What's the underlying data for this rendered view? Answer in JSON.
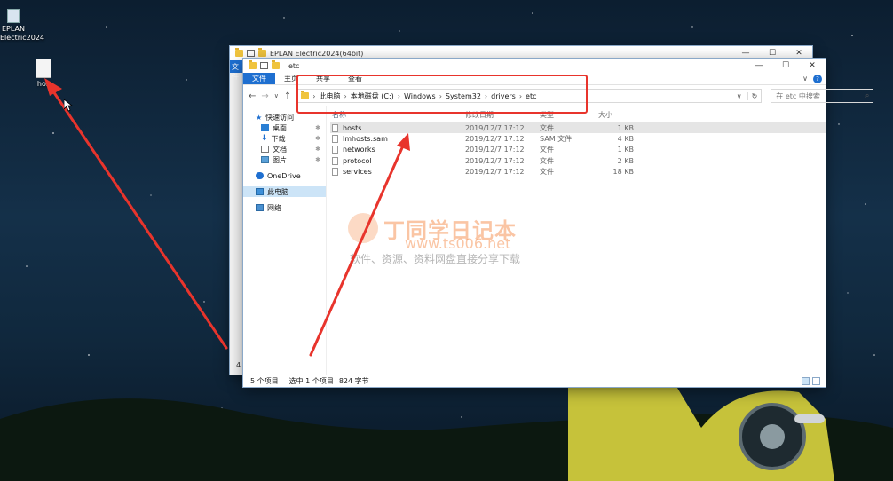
{
  "desktop": {
    "icon1": {
      "label_lines": [
        "EPLAN",
        "Electric2024"
      ]
    },
    "icon2": {
      "label": "hos"
    }
  },
  "back_window": {
    "title": "EPLAN Electric2024(64bit)",
    "file_tab": "文件",
    "left_edge_digit": "4"
  },
  "window": {
    "title": "etc",
    "ribbon": {
      "file": "文件",
      "home": "主页",
      "share": "共享",
      "view": "查看",
      "help": "?"
    },
    "controls": {
      "minimize": "—",
      "maximize": "☐",
      "close": "✕"
    },
    "nav_buttons": {
      "back": "←",
      "forward": "→",
      "recent": "∨",
      "up": "↑"
    },
    "address": {
      "crumbs": [
        "此电脑",
        "本地磁盘 (C:)",
        "Windows",
        "System32",
        "drivers",
        "etc"
      ],
      "separator": "›",
      "dropdown": "∨",
      "refresh": "↻"
    },
    "search": {
      "placeholder": "在 etc 中搜索",
      "icon": "⌕"
    },
    "nav_pane": {
      "quick_access": "快速访问",
      "desktop": "桌面",
      "downloads": "下载",
      "documents": "文档",
      "pictures": "图片",
      "pin": "✱",
      "onedrive": "OneDrive",
      "this_pc": "此电脑",
      "network": "网络"
    },
    "columns": {
      "name": "名称",
      "date": "修改日期",
      "type": "类型",
      "size": "大小"
    },
    "files": [
      {
        "name": "hosts",
        "date": "2019/12/7 17:12",
        "type": "文件",
        "size": "1 KB"
      },
      {
        "name": "lmhosts.sam",
        "date": "2019/12/7 17:12",
        "type": "SAM 文件",
        "size": "4 KB"
      },
      {
        "name": "networks",
        "date": "2019/12/7 17:12",
        "type": "文件",
        "size": "1 KB"
      },
      {
        "name": "protocol",
        "date": "2019/12/7 17:12",
        "type": "文件",
        "size": "2 KB"
      },
      {
        "name": "services",
        "date": "2019/12/7 17:12",
        "type": "文件",
        "size": "18 KB"
      }
    ],
    "status": {
      "count": "5 个项目",
      "selected": "选中 1 个项目",
      "size": "824 字节"
    }
  },
  "watermark": {
    "title": "丁同学日记本",
    "url": "www.ts006.net",
    "subtitle": "软件、资源、资料网盘直接分享下载"
  },
  "colors": {
    "accent": "#1e6fd0",
    "highlight": "#e8342c",
    "selection": "#cce4f7"
  }
}
